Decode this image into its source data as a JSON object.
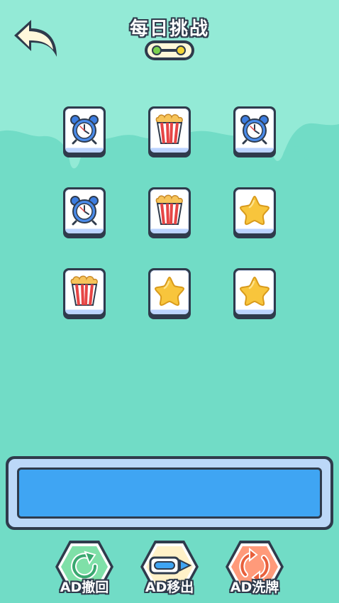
{
  "header": {
    "title": "每日挑战",
    "back_icon": "back-arrow-icon",
    "progress_icon": "level-progress-icon"
  },
  "board": {
    "rows": [
      [
        "alarm-clock",
        "popcorn",
        "alarm-clock"
      ],
      [
        "alarm-clock",
        "popcorn",
        "star"
      ],
      [
        "popcorn",
        "star",
        "star"
      ]
    ]
  },
  "tray": {
    "slots_filled": 0
  },
  "tools": [
    {
      "label": "AD撤回",
      "icon": "undo-icon",
      "color": "#7fe0a8"
    },
    {
      "label": "AD移出",
      "icon": "move-out-icon",
      "color": "#7cc4ff"
    },
    {
      "label": "AD洗牌",
      "icon": "shuffle-icon",
      "color": "#ff9a7a"
    }
  ],
  "colors": {
    "background": "#71dcc6",
    "background_top": "#93ead6",
    "tray_fill": "#3fa5f3",
    "outline": "#2f3b4c"
  }
}
